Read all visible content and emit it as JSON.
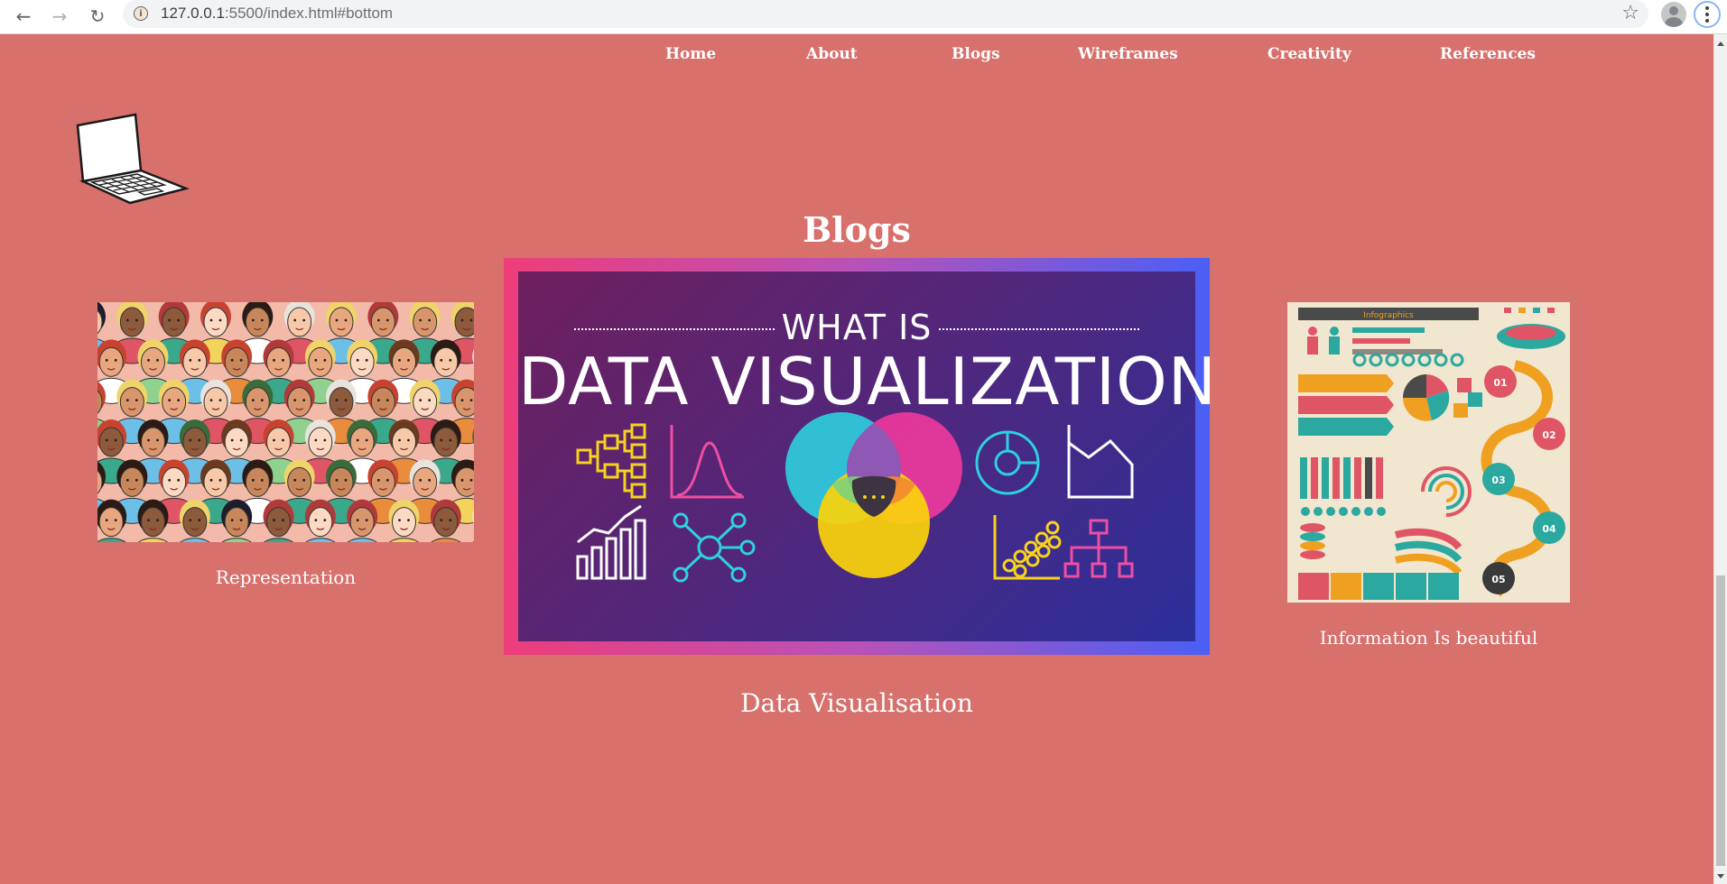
{
  "browser": {
    "url_host": "127.0.0.1",
    "url_rest": ":5500/index.html#bottom"
  },
  "nav": {
    "home": "Home",
    "about": "About",
    "blogs": "Blogs",
    "wireframes": "Wireframes",
    "creativity": "Creativity",
    "references": "References"
  },
  "section": {
    "heading": "Blogs"
  },
  "cards": [
    {
      "caption": "Representation"
    },
    {
      "caption": "Data Visualisation",
      "image_line1": "WHAT IS",
      "image_line2": "DATA VISUALIZATION?"
    },
    {
      "caption": "Information Is beautiful",
      "image_banner": "Infographics"
    }
  ],
  "icons": {
    "back": "arrow-left",
    "forward": "arrow-right",
    "reload": "reload",
    "info": "info-circle",
    "bookmark": "star",
    "profile": "avatar",
    "menu": "kebab-menu",
    "logo": "laptop"
  }
}
